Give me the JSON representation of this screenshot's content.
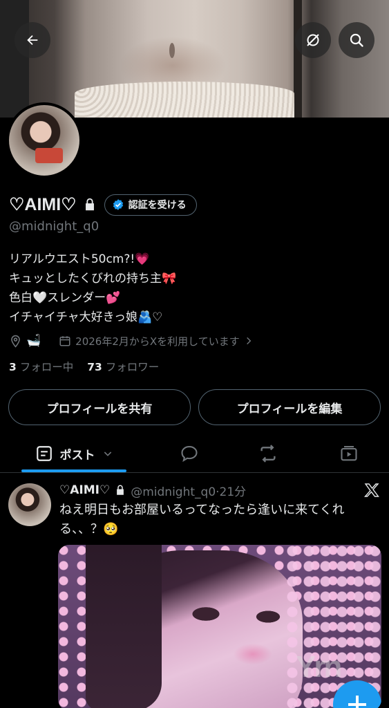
{
  "profile": {
    "display_name": "♡AIMI♡",
    "verify_button": "認証を受ける",
    "handle": "@midnight_q0",
    "bio_lines": [
      "リアルウエスト50cm?!💗",
      "キュッとしたくびれの持ち主🎀",
      "色白🤍スレンダー💕",
      "イチャイチャ大好きっ娘🫂♡"
    ],
    "location_emoji": "🛁",
    "joined": "2026年2月からXを利用しています",
    "following_count": "3",
    "following_label": "フォロー中",
    "followers_count": "73",
    "followers_label": "フォロワー",
    "share_button": "プロフィールを共有",
    "edit_button": "プロフィールを編集"
  },
  "tabs": {
    "posts_label": "ポスト"
  },
  "post": {
    "name": "♡AIMI♡",
    "meta": "@midnight_q0·21分",
    "text": "ねえ明日もお部屋いるってなったら逢いに来てくれる、、？🥺"
  },
  "watermark": "Yrn",
  "colors": {
    "accent": "#1d9bf0",
    "background": "#000000",
    "text_primary": "#e7e9ea",
    "text_secondary": "#71767b",
    "border": "#2f3336"
  },
  "icons": [
    "back-arrow-icon",
    "muted-circle-icon",
    "search-icon",
    "lock-icon",
    "verified-badge-icon",
    "location-pin-icon",
    "calendar-icon",
    "chevron-right-icon",
    "post-tab-icon",
    "chevron-down-icon",
    "reply-bubble-icon",
    "repost-icon",
    "video-tab-icon",
    "x-logo-icon",
    "compose-plus-icon"
  ]
}
